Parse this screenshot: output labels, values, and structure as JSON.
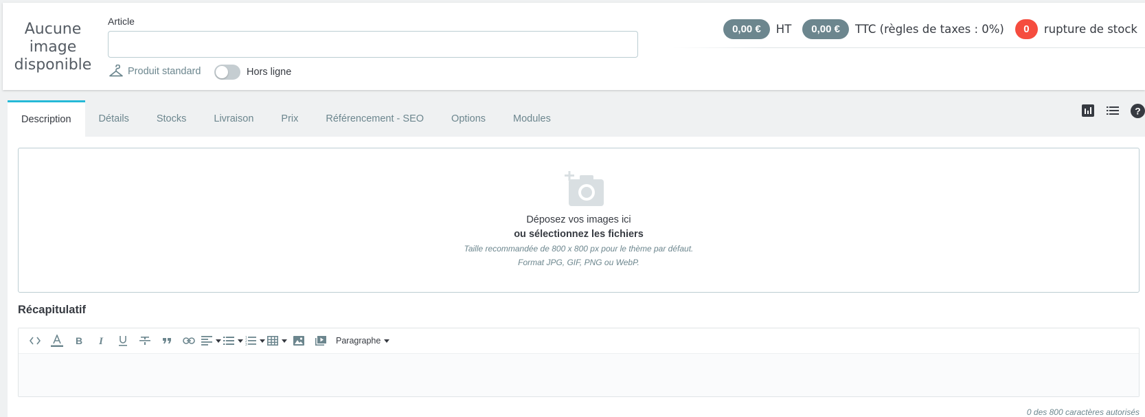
{
  "header": {
    "no_image_text": "Aucune image disponible",
    "article_label": "Article",
    "article_value": "",
    "product_type": "Produit standard",
    "online_toggle_label": "Hors ligne",
    "online_toggle_on": false,
    "price_ht": "0,00 €",
    "price_ht_suffix": "HT",
    "price_ttc": "0,00 €",
    "price_ttc_suffix": "TTC (règles de taxes : 0%)",
    "stock_count": "0",
    "stock_label": "rupture de stock"
  },
  "tabs": [
    {
      "label": "Description",
      "active": true
    },
    {
      "label": "Détails",
      "active": false
    },
    {
      "label": "Stocks",
      "active": false
    },
    {
      "label": "Livraison",
      "active": false
    },
    {
      "label": "Prix",
      "active": false
    },
    {
      "label": "Référencement - SEO",
      "active": false
    },
    {
      "label": "Options",
      "active": false
    },
    {
      "label": "Modules",
      "active": false
    }
  ],
  "tab_icons": [
    "bar-chart-icon",
    "list-icon",
    "help-icon"
  ],
  "dropzone": {
    "main": "Déposez vos images ici",
    "sub": "ou sélectionnez les fichiers",
    "hint1": "Taille recommandée de 800 x 800 px pour le thème par défaut.",
    "hint2": "Format JPG, GIF, PNG ou WebP."
  },
  "summary_section": {
    "title": "Récapitulatif",
    "toolbar": [
      "code-view-icon",
      "font-color-icon",
      "bold-icon",
      "italic-icon",
      "underline-icon",
      "strikethrough-icon",
      "quote-icon",
      "link-icon",
      "align-icon",
      "bullet-list-icon",
      "numbered-list-icon",
      "table-icon",
      "image-icon",
      "video-icon"
    ],
    "paragraph_label": "Paragraphe",
    "counter": "0 des 800 caractères autorisés"
  },
  "colors": {
    "accent": "#25b9d7",
    "pill": "#6c868e",
    "danger": "#f54c3e"
  }
}
